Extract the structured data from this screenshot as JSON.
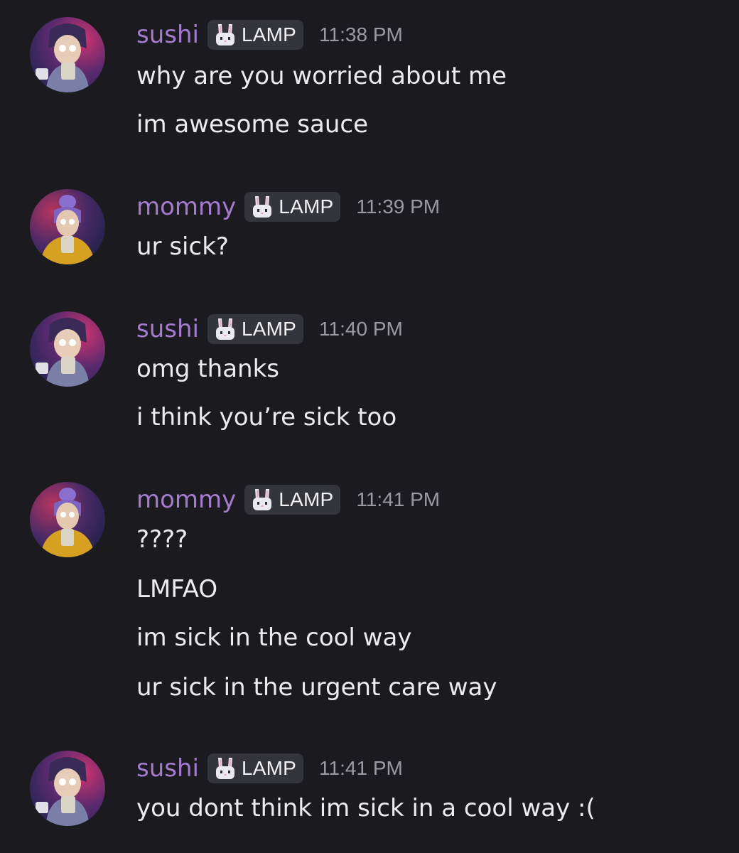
{
  "chat": {
    "groups": [
      {
        "author": "sushi",
        "tag": "LAMP",
        "time": "11:38 PM",
        "messages": [
          "why are you worried about me",
          "im awesome sauce"
        ]
      },
      {
        "author": "mommy",
        "tag": "LAMP",
        "time": "11:39 PM",
        "messages": [
          "ur sick?"
        ]
      },
      {
        "author": "sushi",
        "tag": "LAMP",
        "time": "11:40 PM",
        "messages": [
          "omg thanks",
          "i think you’re sick too"
        ]
      },
      {
        "author": "mommy",
        "tag": "LAMP",
        "time": "11:41 PM",
        "messages": [
          "????",
          "LMFAO",
          "im sick in the cool way",
          "ur sick in the urgent care way"
        ]
      },
      {
        "author": "sushi",
        "tag": "LAMP",
        "time": "11:41 PM",
        "messages": [
          "you dont think im sick in a cool way :("
        ]
      }
    ]
  },
  "colors": {
    "background": "#1b1b1f",
    "username": "#a57bd0",
    "message_text": "#ececf0",
    "timestamp": "#9a9aa3",
    "tag_background": "#34343b"
  },
  "icons": {
    "avatar": "avatar-icon",
    "tag": "bunny-icon"
  }
}
